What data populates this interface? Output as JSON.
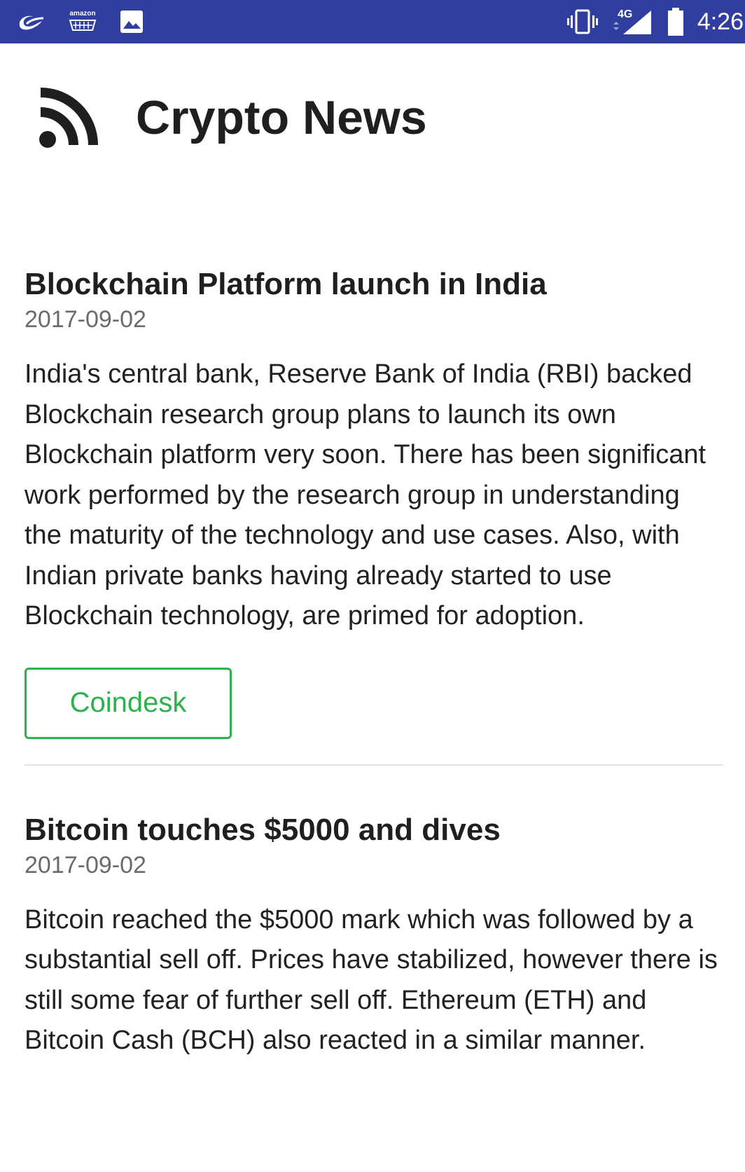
{
  "status_bar": {
    "left_icons": [
      "alibaba-icon",
      "amazon-icon",
      "gallery-icon"
    ],
    "amazon_label": "amazon",
    "right_icons": [
      "vibrate-icon",
      "signal-4g-icon",
      "battery-icon"
    ],
    "network_label": "4G",
    "time": "4:26",
    "background_color": "#303f9f"
  },
  "header": {
    "icon": "rss-icon",
    "title": "Crypto News"
  },
  "articles": [
    {
      "title": "Blockchain Platform launch in India",
      "date": "2017-09-02",
      "body": "India's central bank, Reserve Bank of India (RBI) backed Blockchain research group plans to launch its own Blockchain platform very soon. There has been significant work performed by the research group in understanding the maturity of the technology and use cases. Also, with Indian private banks having already started to use Blockchain technology, are primed for adoption.",
      "source_label": "Coindesk",
      "source_color": "#2bb24c"
    },
    {
      "title": "Bitcoin touches $5000 and dives",
      "date": "2017-09-02",
      "body": "Bitcoin reached the $5000 mark which was followed by a substantial sell off. Prices have stabilized, however there is still some fear of further sell off. Ethereum (ETH) and Bitcoin Cash (BCH) also reacted in a similar manner."
    }
  ]
}
